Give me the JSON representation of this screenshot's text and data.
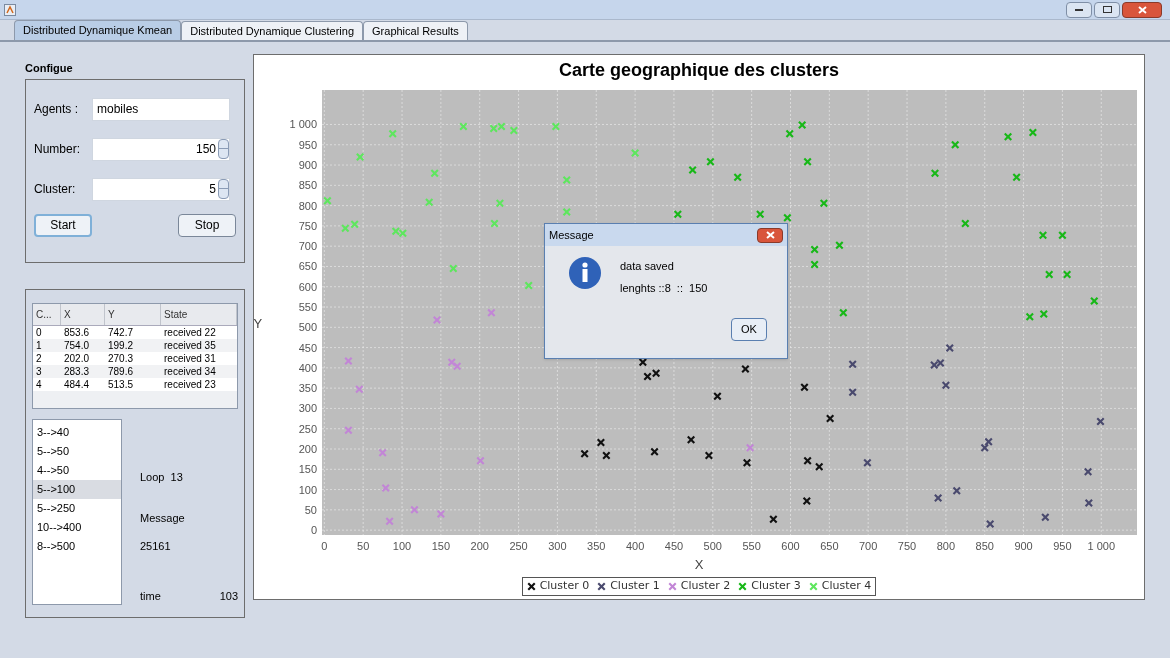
{
  "tabs": [
    {
      "label": "Distributed Dynamique Kmean",
      "selected": true
    },
    {
      "label": "Distributed Dynamique Clustering",
      "selected": false
    },
    {
      "label": "Graphical Results",
      "selected": false
    }
  ],
  "configure": {
    "title": "Configue",
    "agents_label": "Agents :",
    "agents_value": "mobiles",
    "number_label": "Number:",
    "number_value": "150",
    "cluster_label": "Cluster:",
    "cluster_value": "5",
    "buttons": [
      "Start",
      "Stop"
    ]
  },
  "table": {
    "columns": [
      "C...",
      "X",
      "Y",
      "State"
    ],
    "rows": [
      [
        "0",
        "853.6",
        "742.7",
        "received 22"
      ],
      [
        "1",
        "754.0",
        "199.2",
        "received 35"
      ],
      [
        "2",
        "202.0",
        "270.3",
        "received 31"
      ],
      [
        "3",
        "283.3",
        "789.6",
        "received 34"
      ],
      [
        "4",
        "484.4",
        "513.5",
        "received 23"
      ]
    ]
  },
  "list": [
    {
      "label": "3-->40",
      "selected": false
    },
    {
      "label": "5-->50",
      "selected": false
    },
    {
      "label": "4-->50",
      "selected": false
    },
    {
      "label": "5-->100",
      "selected": true
    },
    {
      "label": "5-->250",
      "selected": false
    },
    {
      "label": "10-->400",
      "selected": false
    },
    {
      "label": "8-->500",
      "selected": false
    }
  ],
  "status": {
    "loop": "Loop  13",
    "message_label": "Message",
    "message_value": "25161",
    "time_label": "time",
    "time_value": "103"
  },
  "chart": {
    "chart_data": {
      "type": "scatter",
      "grid": true,
      "title": "Carte geographique des clusters",
      "xlabel": "X",
      "ylabel": "Y",
      "xlim": [
        -3,
        1046
      ],
      "ylim": [
        -12,
        1085
      ],
      "xticks": [
        0,
        50,
        100,
        150,
        200,
        250,
        300,
        350,
        400,
        450,
        500,
        550,
        600,
        650,
        700,
        750,
        800,
        850,
        900,
        950,
        {
          "value": 1000,
          "label": "1 000"
        }
      ],
      "yticks": [
        0,
        50,
        100,
        150,
        200,
        250,
        300,
        350,
        400,
        450,
        500,
        550,
        600,
        650,
        700,
        750,
        800,
        850,
        900,
        950,
        {
          "value": 1000,
          "label": "1 000"
        }
      ],
      "series": [
        {
          "name": "Cluster 0",
          "color": "#111111",
          "x": [
            335,
            356,
            363,
            410,
            416,
            427,
            425,
            472,
            495,
            506,
            542,
            544,
            578,
            618,
            622,
            637,
            621,
            651
          ],
          "values": [
            188,
            216,
            184,
            414,
            379,
            387,
            193,
            223,
            184,
            330,
            397,
            166,
            27,
            352,
            171,
            156,
            72,
            275
          ]
        },
        {
          "name": "Cluster 1",
          "color": "#4a4a6e",
          "x": [
            785,
            793,
            805,
            800,
            790,
            814,
            850,
            855,
            857,
            928,
            983,
            984,
            999,
            680,
            680,
            699
          ],
          "values": [
            407,
            412,
            449,
            357,
            79,
            97,
            203,
            218,
            15,
            32,
            144,
            67,
            268,
            409,
            340,
            166
          ]
        },
        {
          "name": "Cluster 2",
          "color": "#c286d6",
          "x": [
            31,
            45,
            31,
            75,
            79,
            84,
            116,
            150,
            145,
            164,
            171,
            215,
            201,
            548
          ],
          "values": [
            417,
            347,
            246,
            191,
            104,
            22,
            50,
            40,
            518,
            414,
            404,
            536,
            171,
            203
          ]
        },
        {
          "name": "Cluster 3",
          "color": "#18b818",
          "x": [
            455,
            474,
            497,
            532,
            561,
            596,
            599,
            615,
            622,
            631,
            631,
            643,
            663,
            668,
            786,
            812,
            825,
            880,
            891,
            912,
            925,
            933,
            950,
            956,
            991,
            926,
            908
          ],
          "values": [
            779,
            888,
            908,
            870,
            779,
            770,
            977,
            999,
            908,
            692,
            655,
            806,
            702,
            536,
            880,
            950,
            756,
            970,
            870,
            980,
            727,
            630,
            727,
            630,
            565,
            533,
            526
          ]
        },
        {
          "name": "Cluster 4",
          "color": "#5ee65e",
          "x": [
            4,
            27,
            39,
            46,
            88,
            92,
            101,
            142,
            135,
            166,
            179,
            218,
            226,
            219,
            228,
            244,
            298,
            263,
            312,
            312,
            400
          ],
          "values": [
            812,
            744,
            754,
            920,
            977,
            737,
            732,
            880,
            808,
            645,
            995,
            990,
            806,
            756,
            995,
            985,
            995,
            603,
            863,
            784,
            930
          ]
        }
      ]
    }
  },
  "dialog": {
    "title": "Message",
    "lines": [
      "data saved",
      "lenghts ::8  ::  150"
    ],
    "button": "OK"
  }
}
